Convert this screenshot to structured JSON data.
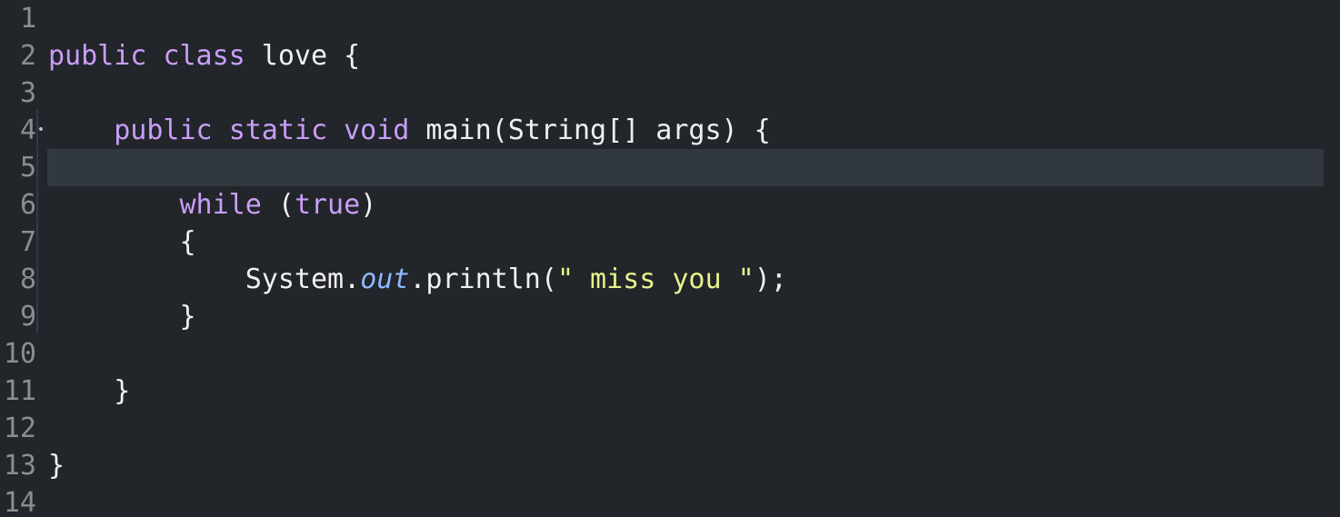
{
  "editor": {
    "lines": [
      {
        "number": "1",
        "indent": "",
        "tokens": []
      },
      {
        "number": "2",
        "indent": "",
        "tokens": [
          {
            "t": "public",
            "c": "kw"
          },
          {
            "t": " ",
            "c": "pl"
          },
          {
            "t": "class",
            "c": "kw"
          },
          {
            "t": " love {",
            "c": "pl"
          }
        ]
      },
      {
        "number": "3",
        "indent": "",
        "tokens": []
      },
      {
        "number": "4",
        "indent": "    ",
        "fold": "•",
        "tokens": [
          {
            "t": "public",
            "c": "kw"
          },
          {
            "t": " ",
            "c": "pl"
          },
          {
            "t": "static",
            "c": "kw"
          },
          {
            "t": " ",
            "c": "pl"
          },
          {
            "t": "void",
            "c": "kw"
          },
          {
            "t": " main(String[] args) {",
            "c": "pl"
          }
        ]
      },
      {
        "number": "5",
        "indent": "",
        "current": true,
        "tokens": []
      },
      {
        "number": "6",
        "indent": "        ",
        "tokens": [
          {
            "t": "while",
            "c": "kw"
          },
          {
            "t": " (",
            "c": "pl"
          },
          {
            "t": "true",
            "c": "kw"
          },
          {
            "t": ")",
            "c": "pl"
          }
        ]
      },
      {
        "number": "7",
        "indent": "        ",
        "tokens": [
          {
            "t": "{",
            "c": "pl"
          }
        ]
      },
      {
        "number": "8",
        "indent": "            ",
        "tokens": [
          {
            "t": "System.",
            "c": "pl"
          },
          {
            "t": "out",
            "c": "fld"
          },
          {
            "t": ".println(",
            "c": "pl"
          },
          {
            "t": "\" miss you \"",
            "c": "str"
          },
          {
            "t": ");",
            "c": "pl"
          }
        ]
      },
      {
        "number": "9",
        "indent": "        ",
        "tokens": [
          {
            "t": "}",
            "c": "pl"
          }
        ]
      },
      {
        "number": "10",
        "indent": "",
        "tokens": []
      },
      {
        "number": "11",
        "indent": "    ",
        "tokens": [
          {
            "t": "}",
            "c": "pl"
          }
        ]
      },
      {
        "number": "12",
        "indent": "",
        "tokens": []
      },
      {
        "number": "13",
        "indent": "",
        "tokens": [
          {
            "t": "}",
            "c": "pl"
          }
        ]
      },
      {
        "number": "14",
        "indent": "",
        "tokens": []
      }
    ]
  },
  "colors": {
    "background": "#22252a",
    "current_line": "#323840",
    "keyword": "#c99ef7",
    "plain": "#f0f0f0",
    "field": "#8fb7ff",
    "string": "#e6f38a",
    "line_number": "#8a8d91"
  }
}
